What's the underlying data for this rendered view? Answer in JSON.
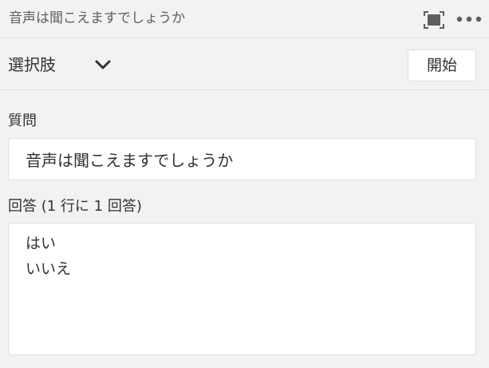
{
  "header": {
    "title": "音声は聞こえますでしょうか",
    "expand_icon": "expand-icon",
    "more_icon": "more-options-icon"
  },
  "toolbar": {
    "type_label": "選択肢",
    "chevron_icon": "chevron-down-icon",
    "start_label": "開始"
  },
  "form": {
    "question_label": "質問",
    "question_value": "音声は聞こえますでしょうか",
    "answers_label": "回答 (1 行に 1 回答)",
    "answers": [
      "はい",
      "いいえ"
    ]
  }
}
